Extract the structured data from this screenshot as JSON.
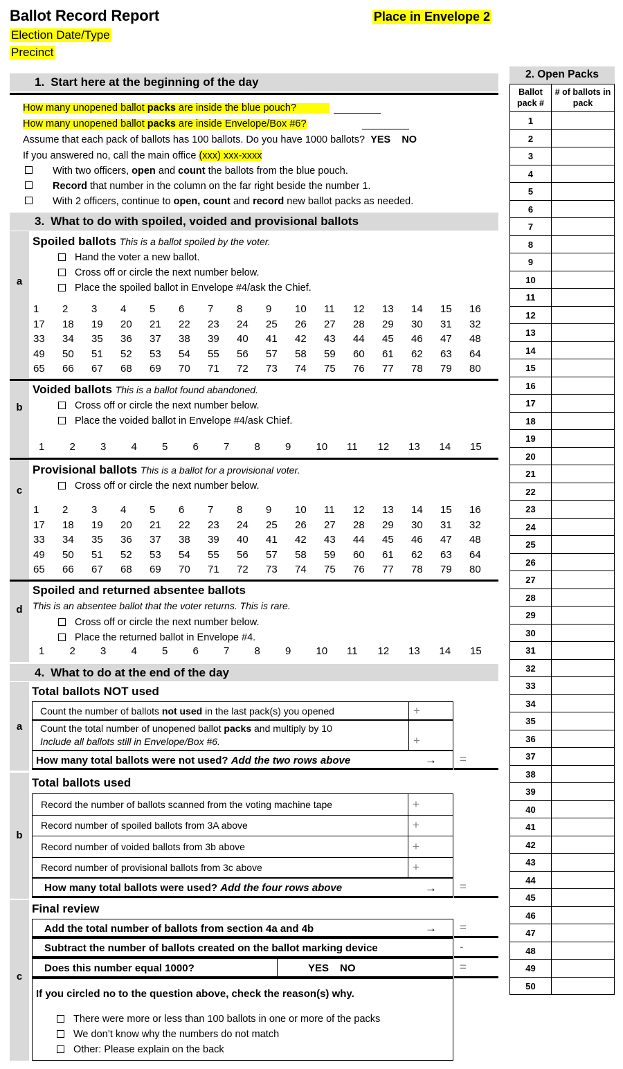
{
  "header": {
    "title": "Ballot Record Report",
    "right_note": "Place in Envelope 2",
    "line1": "Election Date/Type",
    "line2": "Precinct"
  },
  "section1": {
    "heading_num": "1.",
    "heading": "Start here at the beginning of the day",
    "q1": "How many unopened ballot",
    "q1_bold": "packs",
    "q1_end": "are inside the blue pouch?",
    "q2": "How many unopened ballot",
    "q2_bold": "packs",
    "q2_end": "are inside Envelope/Box #6?",
    "assume": "Assume that each pack of ballots has 100 ballots. Do you have 1000 ballots?",
    "yes": "YES",
    "no": "NO",
    "call_prefix": "If you answered no, call the main office",
    "phone": "(xxx) xxx-xxxx",
    "checks": [
      {
        "pre": "With two officers,",
        "b1": "open",
        "mid": "and",
        "b2": "count",
        "post": "the ballots from the blue pouch."
      },
      {
        "pre": "",
        "b1": "Record",
        "mid": "",
        "b2": "",
        "post": "that number in the column on the far right beside the number 1."
      },
      {
        "pre": "With 2 officers, continue to",
        "b1": "open, count",
        "mid": "and",
        "b2": "record",
        "post": "new ballot packs as needed."
      }
    ]
  },
  "section2": {
    "title": "2. Open Packs",
    "col1": "Ballot pack #",
    "col2": "# of ballots in pack",
    "rows": [
      1,
      2,
      3,
      4,
      5,
      6,
      7,
      8,
      9,
      10,
      11,
      12,
      13,
      14,
      15,
      16,
      17,
      18,
      19,
      20,
      21,
      22,
      23,
      24,
      25,
      26,
      27,
      28,
      29,
      30,
      31,
      32,
      33,
      34,
      35,
      36,
      37,
      38,
      39,
      40,
      41,
      42,
      43,
      44,
      45,
      46,
      47,
      48,
      49,
      50
    ]
  },
  "section3": {
    "heading_num": "3.",
    "heading": "What to do with spoiled, voided and provisional ballots",
    "a": {
      "letter": "a",
      "title": "Spoiled ballots",
      "desc": "This is a ballot spoiled by the voter.",
      "checks": [
        "Hand the voter a new ballot.",
        "Cross off or circle the next number below.",
        "Place the spoiled ballot in Envelope #4/ask the Chief."
      ],
      "max": 80
    },
    "b": {
      "letter": "b",
      "title": "Voided ballots",
      "desc": "This is a ballot found abandoned.",
      "checks": [
        "Cross off or circle the next number below.",
        "Place the voided ballot in Envelope #4/ask Chief."
      ],
      "max": 15
    },
    "c": {
      "letter": "c",
      "title": "Provisional ballots",
      "desc": "This is a ballot for a provisional voter.",
      "checks": [
        "Cross off or circle the next number below."
      ],
      "max": 80
    },
    "d": {
      "letter": "d",
      "title": "Spoiled and returned absentee ballots",
      "desc": "This is an absentee ballot that the voter returns. This is rare.",
      "checks": [
        "Cross off or circle the next number below.",
        "Place the returned ballot in Envelope #4."
      ],
      "max": 15
    }
  },
  "section4": {
    "heading_num": "4.",
    "heading": "What to do at the end of the day",
    "a": {
      "letter": "a",
      "title": "Total ballots NOT used",
      "rows": [
        {
          "pre": "Count the number of ballots",
          "bold": "not used",
          "post": "in the last pack(s) you opened",
          "op": "+"
        },
        {
          "pre": "Count the total number of unopened ballot",
          "bold": "packs",
          "post": "and multiply by 10",
          "sub": "Include all ballots still in Envelope/Box #6.",
          "op": "+"
        }
      ],
      "total_label": "How many total ballots were not used?",
      "total_italic": "Add the two rows above",
      "arrow": "→",
      "equals": "="
    },
    "b": {
      "letter": "b",
      "title": "Total ballots used",
      "rows": [
        {
          "label": "Record the number of ballots scanned from the voting machine tape",
          "op": "+"
        },
        {
          "label": "Record number of spoiled ballots from 3A above",
          "op": "+"
        },
        {
          "label": "Record number of voided ballots from 3b above",
          "op": "+"
        },
        {
          "label": "Record number of provisional ballots from 3c above",
          "op": "+"
        }
      ],
      "total_label": "How many total ballots were used?",
      "total_italic": "Add the four rows above",
      "arrow": "→",
      "equals": "="
    },
    "c": {
      "letter": "c",
      "title": "Final review",
      "row1": "Add the total number of ballots from section 4a and 4b",
      "row1_arrow": "→",
      "row1_op": "=",
      "row2": "Subtract the number of ballots created on the ballot marking device",
      "row2_op": "-",
      "row3": "Does this number equal 1000?",
      "row3_yes": "YES",
      "row3_no": "NO",
      "row3_op": "=",
      "reason_prompt": "If you circled no to the question above, check the reason(s) why.",
      "reasons": [
        "There were more or less than 100 ballots in one or more of the packs",
        "We don’t know why the numbers do not match",
        "Other: Please explain on the back"
      ]
    }
  },
  "colors": {
    "highlight": "#ffff00",
    "section_bar": "#d9d9d9",
    "gutter": "#d9d9d9",
    "op_gray": "#808080"
  }
}
